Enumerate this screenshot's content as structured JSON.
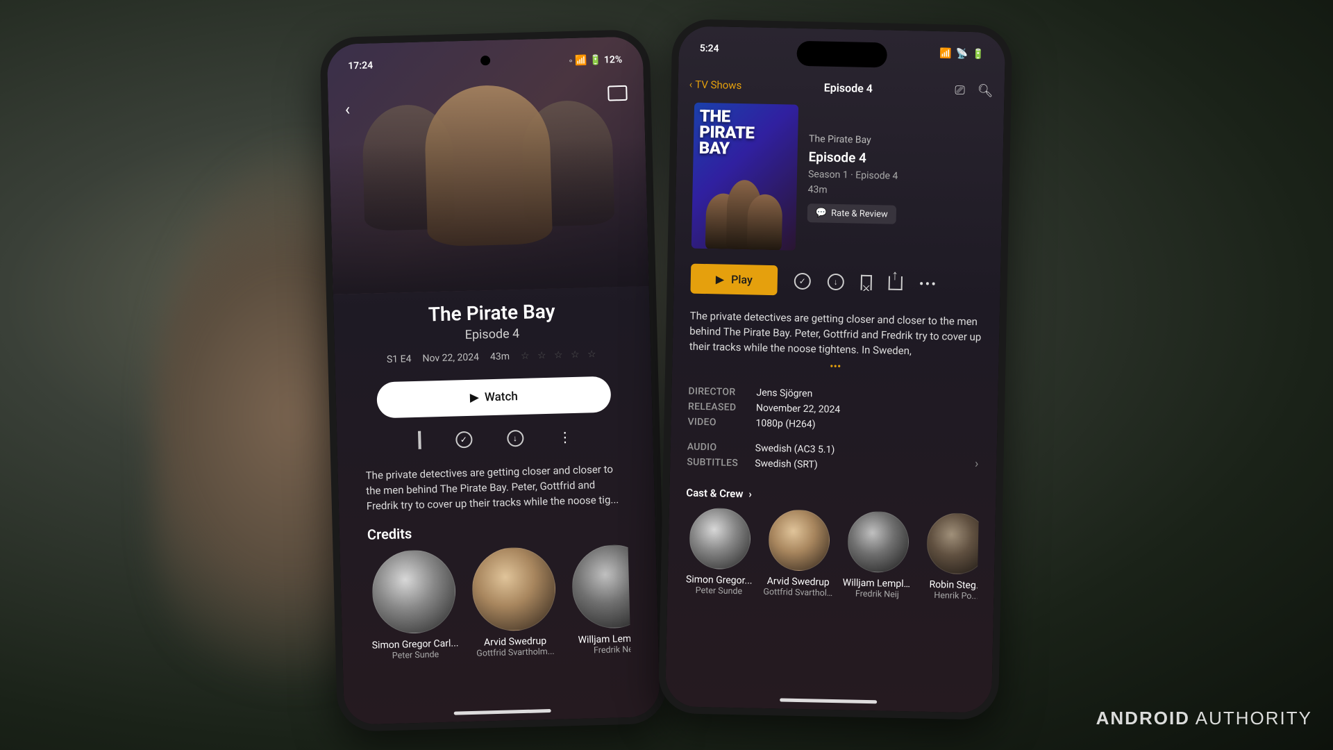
{
  "left_phone": {
    "status": {
      "time": "17:24",
      "right_icons": "◦ 📶 🔋 12%"
    },
    "title": "The Pirate Bay",
    "episode": "Episode 4",
    "meta": {
      "se": "S1 E4",
      "date": "Nov 22, 2024",
      "dur": "43m"
    },
    "watch_label": "Watch",
    "desc": "The private detectives are getting closer and closer to the men behind The Pirate Bay. Peter, Gottfrid and Fredrik try to cover up their tracks while the noose tig...",
    "credits_header": "Credits",
    "cast": [
      {
        "name": "Simon Gregor Carl...",
        "role": "Peter Sunde"
      },
      {
        "name": "Arvid Swedrup",
        "role": "Gottfrid Svartholm..."
      },
      {
        "name": "Willjam Lempling",
        "role": "Fredrik Neij"
      }
    ]
  },
  "right_phone": {
    "status": {
      "time": "5:24"
    },
    "nav": {
      "back": "TV Shows",
      "title": "Episode 4"
    },
    "poster_title": "THE PIRATE BAY",
    "info": {
      "show": "The Pirate Bay",
      "episode": "Episode 4",
      "meta": "Season 1  ·  Episode 4",
      "dur": "43m",
      "rate": "Rate & Review"
    },
    "play_label": "Play",
    "desc": "The private detectives are getting closer and closer to the men behind The Pirate Bay. Peter, Gottfrid and Fredrik try to cover up their tracks while the noose tightens. In Sweden,",
    "details": [
      {
        "label": "DIRECTOR",
        "val": "Jens Sjögren"
      },
      {
        "label": "RELEASED",
        "val": "November 22, 2024"
      },
      {
        "label": "VIDEO",
        "val": "1080p (H264)"
      }
    ],
    "details2": [
      {
        "label": "AUDIO",
        "val": "Swedish (AC3 5.1)"
      },
      {
        "label": "SUBTITLES",
        "val": "Swedish (SRT)"
      }
    ],
    "cast_header": "Cast & Crew",
    "cast": [
      {
        "name": "Simon Gregor...",
        "role": "Peter Sunde"
      },
      {
        "name": "Arvid Swedrup",
        "role": "Gottfrid Svartholm Warg"
      },
      {
        "name": "Willjam Lempling",
        "role": "Fredrik Neij"
      },
      {
        "name": "Robin Steg...",
        "role": "Henrik Po..."
      }
    ]
  },
  "watermark": {
    "a": "ANDROID",
    "b": "AUTHORITY"
  }
}
